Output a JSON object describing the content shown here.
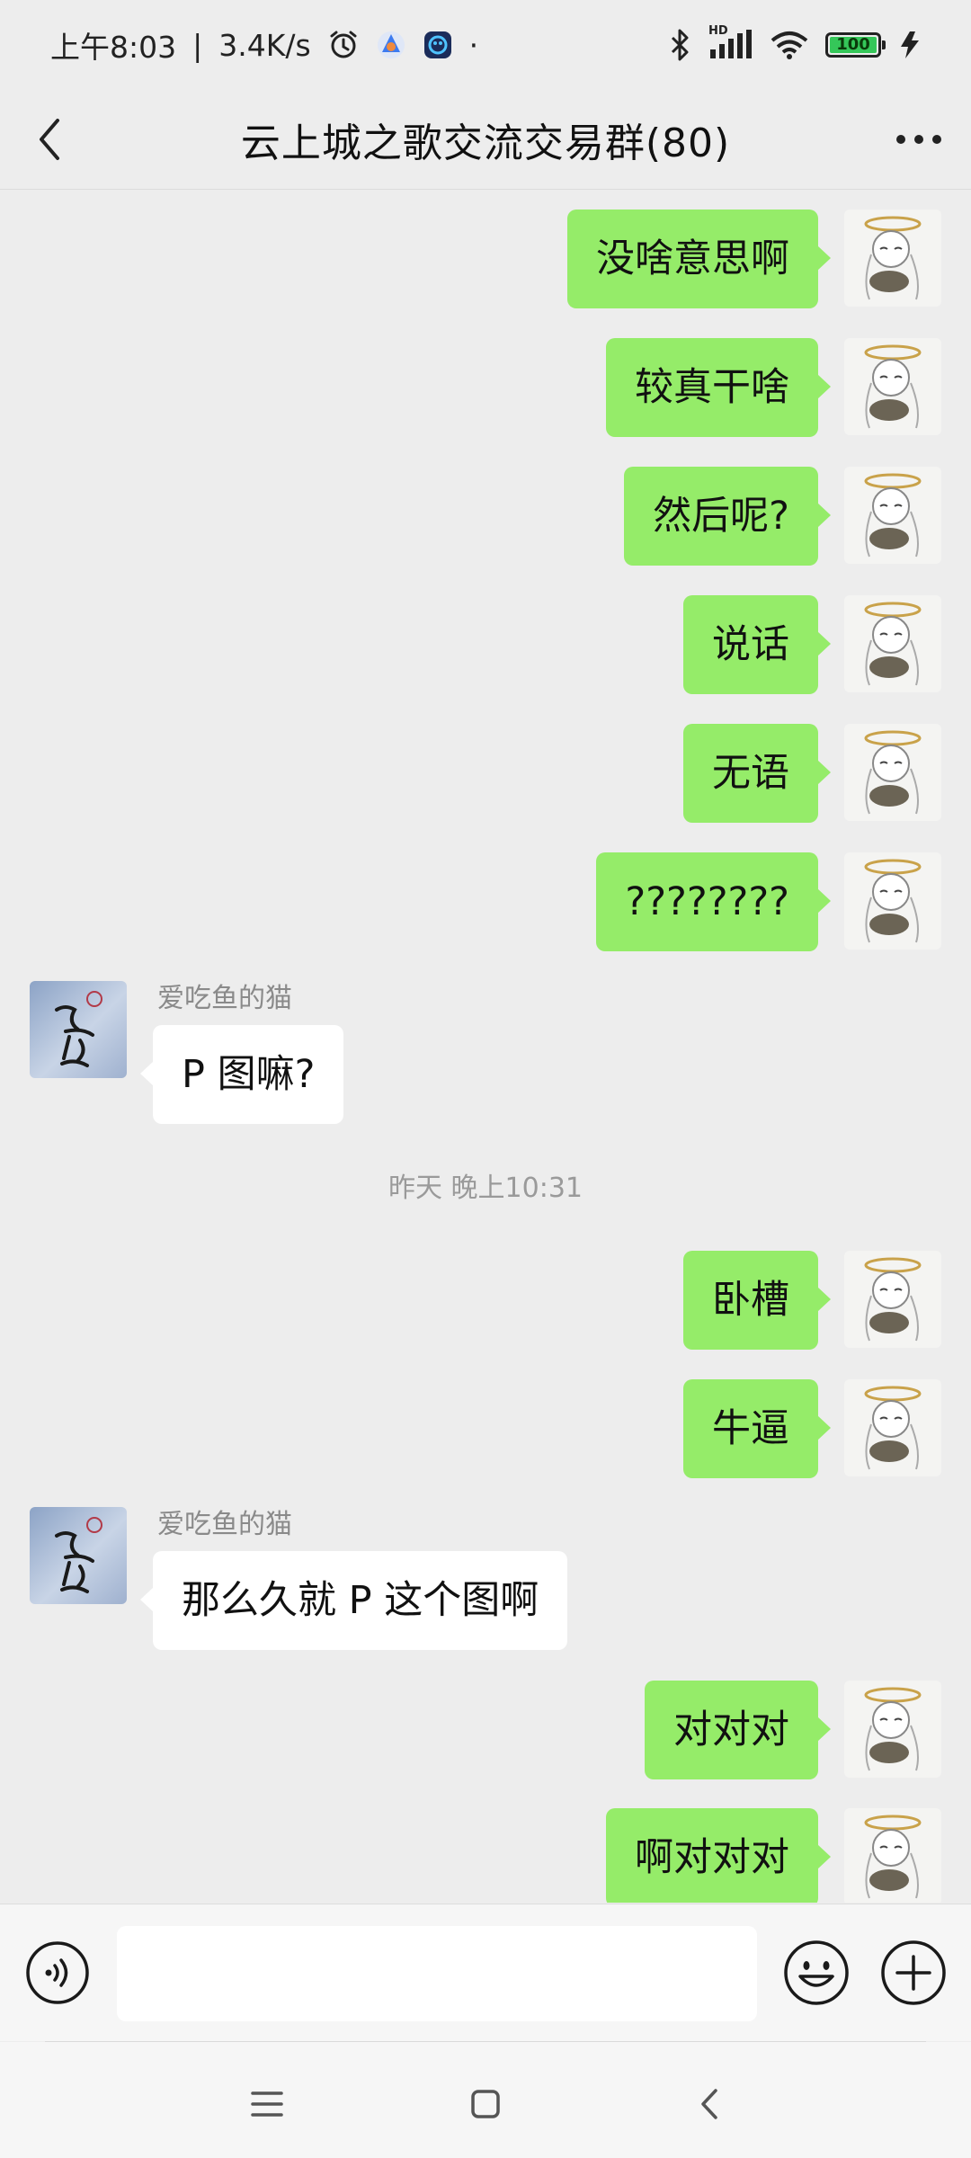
{
  "status_bar": {
    "time": "上午8:03",
    "separator": "|",
    "net_speed": "3.4K/s",
    "dot": "·",
    "hd_label": "HD",
    "battery": "100",
    "icons": [
      "alarm-icon",
      "app-icon",
      "app-icon",
      "bluetooth-icon",
      "signal-icon",
      "wifi-icon",
      "battery-icon",
      "charging-icon"
    ]
  },
  "header": {
    "title": "云上城之歌交流交易群(80)",
    "back_icon": "chevron-left-icon",
    "more_icon": "more-dots-icon"
  },
  "messages": [
    {
      "dir": "out",
      "text": "没啥意思啊"
    },
    {
      "dir": "out",
      "text": "较真干啥"
    },
    {
      "dir": "out",
      "text": "然后呢?"
    },
    {
      "dir": "out",
      "text": "说话"
    },
    {
      "dir": "out",
      "text": "无语"
    },
    {
      "dir": "out",
      "text": "????????"
    },
    {
      "dir": "in",
      "sender": "爱吃鱼的猫",
      "text": "P 图嘛?"
    },
    {
      "dir": "time",
      "text": "昨天 晚上10:31"
    },
    {
      "dir": "out",
      "text": "卧槽"
    },
    {
      "dir": "out",
      "text": "牛逼"
    },
    {
      "dir": "in",
      "sender": "爱吃鱼的猫",
      "text": "那么久就 P 这个图啊"
    },
    {
      "dir": "out",
      "text": "对对对"
    },
    {
      "dir": "out",
      "text": "啊对对对"
    }
  ],
  "input_bar": {
    "value": "",
    "placeholder": "",
    "voice_icon": "voice-icon",
    "emoji_icon": "emoji-icon",
    "plus_icon": "plus-icon"
  },
  "system_nav": [
    "menu-icon",
    "home-icon",
    "back-icon"
  ],
  "colors": {
    "background": "#ededed",
    "outgoing_bubble": "#95ec69",
    "incoming_bubble": "#ffffff",
    "battery_fill": "#35c759"
  }
}
